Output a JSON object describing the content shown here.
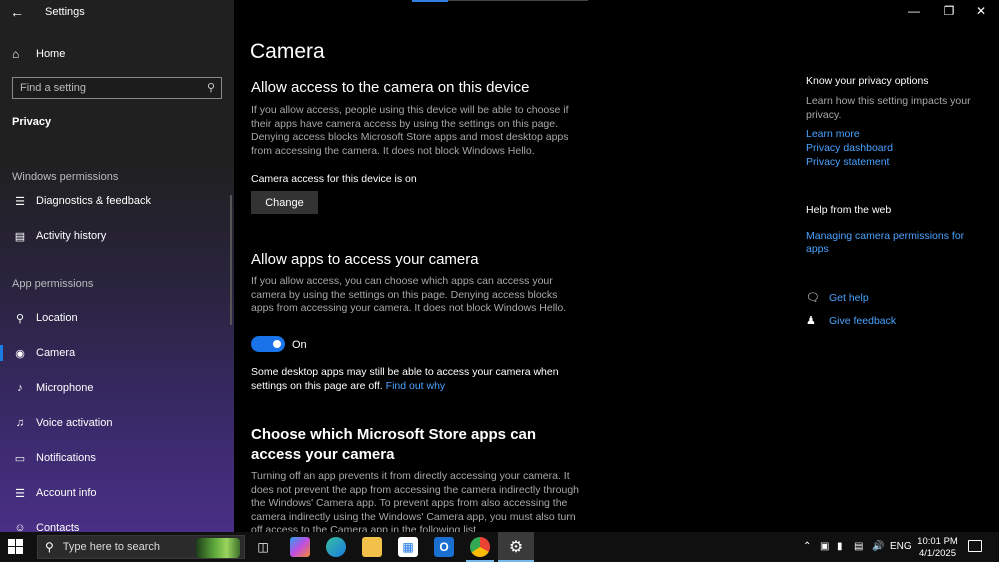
{
  "window": {
    "app_title": "Settings"
  },
  "sidebar": {
    "home_label": "Home",
    "search_placeholder": "Find a setting",
    "section_title": "Privacy",
    "windows_permissions_label": "Windows permissions",
    "windows_permissions_items": [
      {
        "label": "Diagnostics & feedback",
        "icon": "diagnostics-icon"
      },
      {
        "label": "Activity history",
        "icon": "activity-icon"
      }
    ],
    "app_permissions_label": "App permissions",
    "app_permissions_items": [
      {
        "label": "Location",
        "icon": "location-icon"
      },
      {
        "label": "Camera",
        "icon": "camera-icon",
        "selected": true
      },
      {
        "label": "Microphone",
        "icon": "microphone-icon"
      },
      {
        "label": "Voice activation",
        "icon": "voice-icon"
      },
      {
        "label": "Notifications",
        "icon": "notifications-icon"
      },
      {
        "label": "Account info",
        "icon": "account-icon"
      },
      {
        "label": "Contacts",
        "icon": "contacts-icon"
      }
    ]
  },
  "main": {
    "page_title": "Camera",
    "device_section": {
      "heading": "Allow access to the camera on this device",
      "description": "If you allow access, people using this device will be able to choose if their apps have camera access by using the settings on this page. Denying access blocks Microsoft Store apps and most desktop apps from accessing the camera. It does not block Windows Hello.",
      "status": "Camera access for this device is on",
      "change_button": "Change"
    },
    "apps_section": {
      "heading": "Allow apps to access your camera",
      "description": "If you allow access, you can choose which apps can access your camera by using the settings on this page. Denying access blocks apps from accessing your camera. It does not block Windows Hello.",
      "toggle_state": "On",
      "toggle_on": true,
      "note": "Some desktop apps may still be able to access your camera when settings on this page are off.",
      "note_link": "Find out why"
    },
    "store_section": {
      "heading": "Choose which Microsoft Store apps can access your camera",
      "description": "Turning off an app prevents it from directly accessing your camera. It does not prevent the app from accessing the camera indirectly through the Windows' Camera app. To prevent apps from also accessing the camera indirectly using the Windows' Camera app, you must also turn off access to the Camera app in the following list."
    }
  },
  "right_panel": {
    "privacy_heading": "Know your privacy options",
    "privacy_text": "Learn how this setting impacts your privacy.",
    "links": [
      "Learn more",
      "Privacy dashboard",
      "Privacy statement"
    ],
    "help_heading": "Help from the web",
    "help_link": "Managing camera permissions for apps",
    "get_help": "Get help",
    "give_feedback": "Give feedback"
  },
  "taskbar": {
    "search_placeholder": "Type here to search",
    "language": "ENG",
    "time": "10:01 PM",
    "date": "4/1/2025"
  },
  "colors": {
    "accent": "#1a73e8",
    "link": "#4aa3ff",
    "background": "#000000",
    "sidebar": "#202020"
  }
}
